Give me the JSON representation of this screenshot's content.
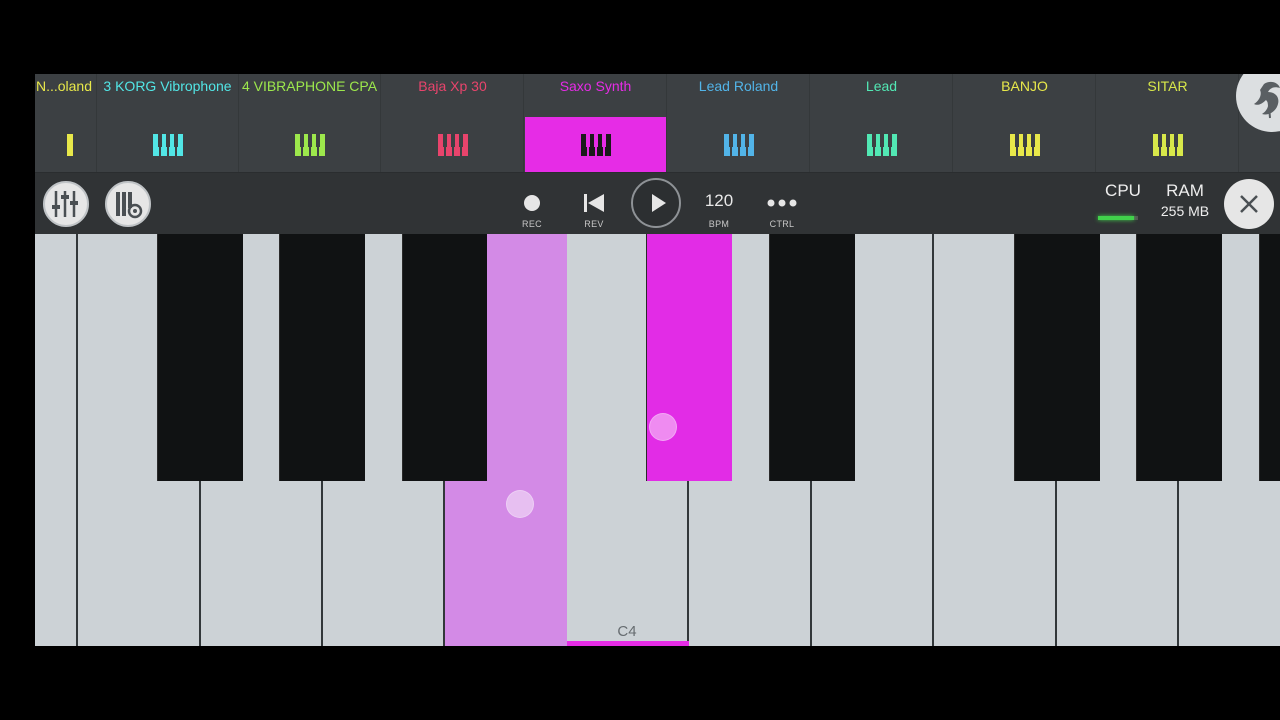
{
  "channels": [
    {
      "name": "N...oland",
      "color": "#e8e84a"
    },
    {
      "name": "3 KORG Vibrophone",
      "color": "#52e6e6"
    },
    {
      "name": "4 VIBRAPHONE CPA",
      "color": "#9de84c"
    },
    {
      "name": "Baja Xp 30",
      "color": "#e8446c"
    },
    {
      "name": "Saxo Synth",
      "color": "#e62ce6",
      "active": true
    },
    {
      "name": "Lead Roland",
      "color": "#52b4e8"
    },
    {
      "name": "Lead",
      "color": "#52e8b4"
    },
    {
      "name": "BANJO",
      "color": "#e8e84a"
    },
    {
      "name": "SITAR",
      "color": "#d8e84a"
    }
  ],
  "toolbar": {
    "rec_label": "REC",
    "rev_label": "REV",
    "bpm_value": "120",
    "bpm_label": "BPM",
    "ctrl_label": "CTRL",
    "cpu_label": "CPU",
    "cpu_level": 0.9,
    "ram_label": "RAM",
    "ram_value": "255 MB"
  },
  "keyboard": {
    "key_label": "C4",
    "pressed_color": "#e22ce6",
    "pressed_white_color": "#d38ae6"
  }
}
